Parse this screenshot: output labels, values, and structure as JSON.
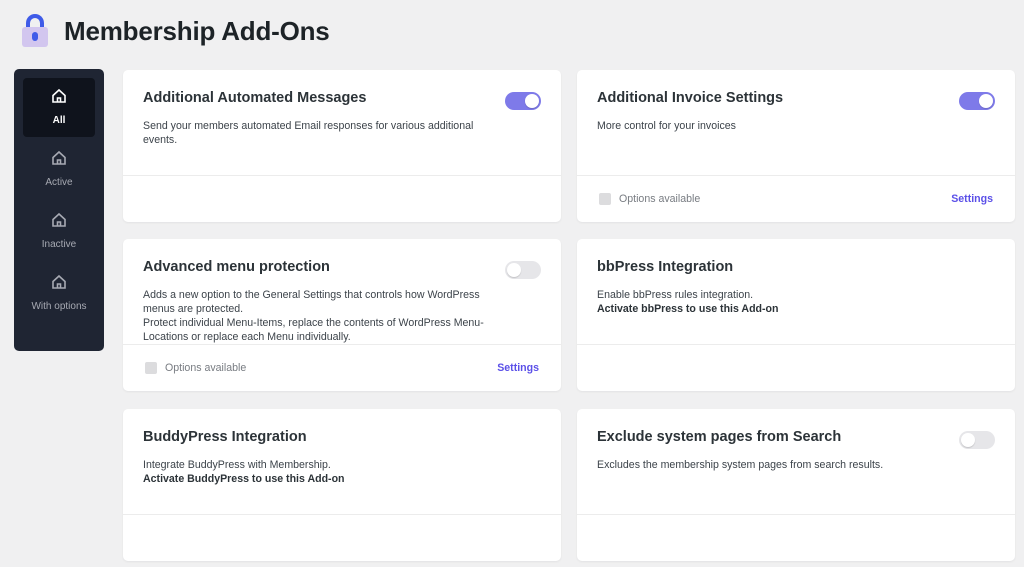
{
  "header": {
    "title": "Membership Add-Ons",
    "icon": "lock-icon"
  },
  "sidebar": {
    "items": [
      {
        "label": "All",
        "active": true
      },
      {
        "label": "Active"
      },
      {
        "label": "Inactive"
      },
      {
        "label": "With options"
      }
    ]
  },
  "colors": {
    "accent": "#5b50e8",
    "toggle_on": "#7e7ae9",
    "sidebar_bg": "#1f2533"
  },
  "cards": [
    {
      "title": "Additional Automated Messages",
      "desc": "Send your members automated Email responses for various additional events.",
      "note": "",
      "enabled": true,
      "options_label": "",
      "settings_label": ""
    },
    {
      "title": "Additional Invoice Settings",
      "desc": "More control for your invoices",
      "note": "",
      "enabled": true,
      "options_label": "Options available",
      "settings_label": "Settings"
    },
    {
      "title": "Advanced menu protection",
      "desc": "Adds a new option to the General Settings that controls how WordPress menus are protected.",
      "desc2": "Protect individual Menu-Items, replace the contents of WordPress Menu-Locations or replace each Menu individually.",
      "note": "",
      "enabled": false,
      "options_label": "Options available",
      "settings_label": "Settings"
    },
    {
      "title": "bbPress Integration",
      "desc": "Enable bbPress rules integration.",
      "note": "Activate bbPress to use this Add-on",
      "enabled": null,
      "options_label": "",
      "settings_label": ""
    },
    {
      "title": "BuddyPress Integration",
      "desc": "Integrate BuddyPress with Membership.",
      "note": "Activate BuddyPress to use this Add-on",
      "enabled": null,
      "options_label": "",
      "settings_label": ""
    },
    {
      "title": "Exclude system pages from Search",
      "desc": "Excludes the membership system pages from search results.",
      "note": "",
      "enabled": false,
      "options_label": "",
      "settings_label": ""
    }
  ]
}
